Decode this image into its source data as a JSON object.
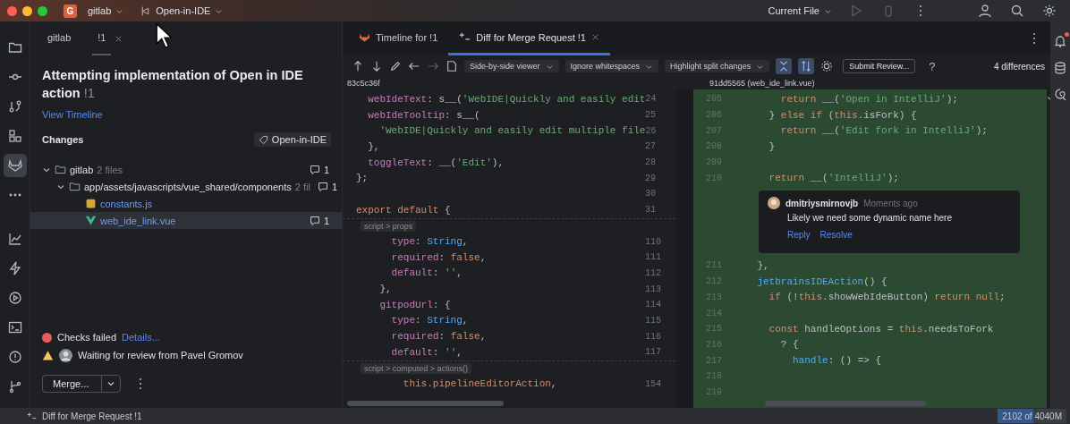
{
  "title_bar": {
    "project_initial": "G",
    "project": "gitlab",
    "branch": "Open-in-IDE",
    "run_config": "Current File",
    "run_disabled": true
  },
  "left_toolbar": {
    "top": [
      {
        "kind": "folder",
        "selected": false
      },
      {
        "kind": "commit",
        "selected": false
      },
      {
        "kind": "pull",
        "selected": false
      },
      {
        "kind": "structure",
        "selected": false
      },
      {
        "kind": "fox",
        "selected": true
      },
      {
        "kind": "more",
        "selected": false
      }
    ],
    "bottom": [
      {
        "kind": "chart",
        "selected": false
      },
      {
        "kind": "bolt",
        "selected": false
      },
      {
        "kind": "play",
        "selected": false
      },
      {
        "kind": "terminal",
        "selected": false
      },
      {
        "kind": "problems",
        "selected": false
      },
      {
        "kind": "git",
        "selected": false
      }
    ]
  },
  "review_panel": {
    "tabs": [
      {
        "label": "gitlab",
        "selected": false
      },
      {
        "label": "!1",
        "selected": true
      }
    ],
    "title": "Attempting implementation of Open in IDE action",
    "title_id": "!1",
    "timeline_link": "View Timeline",
    "changes_label": "Changes",
    "branch_button": "Open-in-IDE",
    "tree": [
      {
        "kind": "dir",
        "name": "gitlab",
        "meta": "2 files",
        "comments": "1",
        "expanded": true,
        "selected": false,
        "children": [
          {
            "kind": "dir",
            "name": "app/assets/javascripts/vue_shared/components",
            "meta": "2 fil",
            "comments": "1",
            "expanded": true,
            "selected": false,
            "children": [
              {
                "kind": "js",
                "name": "constants.js",
                "selected": false
              },
              {
                "kind": "vue",
                "name": "web_ide_link.vue",
                "comments": "1",
                "selected": true
              }
            ]
          }
        ]
      }
    ],
    "checks": {
      "failed": true,
      "label": "Checks failed",
      "link": "Details..."
    },
    "review_status": "Waiting for review from Pavel Gromov",
    "merge_button": "Merge..."
  },
  "editor_tabs": [
    {
      "kind": "fox",
      "label": "Timeline for !1",
      "selected": false
    },
    {
      "kind": "diff",
      "label": "Diff for Merge Request !1",
      "selected": true
    }
  ],
  "diff_toolbar": {
    "dropdowns": [
      "Side-by-side viewer",
      "Ignore whitespaces",
      "Highlight split changes"
    ],
    "toggles": [
      {
        "kind": "collapse",
        "selected": true
      },
      {
        "kind": "sync",
        "selected": true
      }
    ],
    "submit_button": "Submit Review...",
    "help": "?",
    "differences": "4 differences"
  },
  "left_file": "83c5c36f",
  "right_file": "91dd5565 (web_ide_link.vue)",
  "left_lines": [
    {
      "kind": "line",
      "n": "24",
      "code": [
        {
          "kind": "prop",
          "t": "  webIdeText"
        },
        {
          "kind": "plain",
          "t": ": s__("
        },
        {
          "kind": "str",
          "t": "'WebIDE|Quickly and easily edit"
        }
      ]
    },
    {
      "kind": "line",
      "n": "25",
      "code": [
        {
          "kind": "prop",
          "t": "  webIdeTooltip"
        },
        {
          "kind": "plain",
          "t": ": s__("
        }
      ]
    },
    {
      "kind": "line",
      "n": "26",
      "code": [
        {
          "kind": "str",
          "t": "    'WebIDE|Quickly and easily edit multiple file"
        }
      ]
    },
    {
      "kind": "line",
      "n": "27",
      "code": [
        {
          "kind": "plain",
          "t": "  },"
        }
      ]
    },
    {
      "kind": "line",
      "n": "28",
      "code": [
        {
          "kind": "prop",
          "t": "  toggleText"
        },
        {
          "kind": "plain",
          "t": ": __("
        },
        {
          "kind": "str",
          "t": "'Edit'"
        },
        {
          "kind": "plain",
          "t": "),"
        }
      ]
    },
    {
      "kind": "line",
      "n": "29",
      "code": [
        {
          "kind": "plain",
          "t": "};"
        }
      ]
    },
    {
      "kind": "line",
      "n": "30"
    },
    {
      "kind": "line",
      "n": "31",
      "code": [
        {
          "kind": "kw",
          "t": "export default"
        },
        {
          "kind": "plain",
          "t": " {"
        }
      ]
    },
    {
      "kind": "fold",
      "label": "script > props"
    },
    {
      "kind": "line",
      "n": "110",
      "code": [
        {
          "kind": "prop",
          "t": "      type"
        },
        {
          "kind": "plain",
          "t": ": "
        },
        {
          "kind": "type",
          "t": "String"
        },
        {
          "kind": "plain",
          "t": ","
        }
      ]
    },
    {
      "kind": "line",
      "n": "111",
      "code": [
        {
          "kind": "prop",
          "t": "      required"
        },
        {
          "kind": "plain",
          "t": ": "
        },
        {
          "kind": "kw",
          "t": "false"
        },
        {
          "kind": "plain",
          "t": ","
        }
      ]
    },
    {
      "kind": "line",
      "n": "112",
      "code": [
        {
          "kind": "prop",
          "t": "      default"
        },
        {
          "kind": "plain",
          "t": ": "
        },
        {
          "kind": "str",
          "t": "''"
        },
        {
          "kind": "plain",
          "t": ","
        }
      ]
    },
    {
      "kind": "line",
      "n": "113",
      "code": [
        {
          "kind": "plain",
          "t": "    },"
        }
      ]
    },
    {
      "kind": "line",
      "n": "114",
      "code": [
        {
          "kind": "prop",
          "t": "    gitpodUrl"
        },
        {
          "kind": "plain",
          "t": ": {"
        }
      ]
    },
    {
      "kind": "line",
      "n": "115",
      "code": [
        {
          "kind": "prop",
          "t": "      type"
        },
        {
          "kind": "plain",
          "t": ": "
        },
        {
          "kind": "type",
          "t": "String"
        },
        {
          "kind": "plain",
          "t": ","
        }
      ]
    },
    {
      "kind": "line",
      "n": "116",
      "code": [
        {
          "kind": "prop",
          "t": "      required"
        },
        {
          "kind": "plain",
          "t": ": "
        },
        {
          "kind": "kw",
          "t": "false"
        },
        {
          "kind": "plain",
          "t": ","
        }
      ]
    },
    {
      "kind": "line",
      "n": "117",
      "code": [
        {
          "kind": "prop",
          "t": "      default"
        },
        {
          "kind": "plain",
          "t": ": "
        },
        {
          "kind": "str",
          "t": "''"
        },
        {
          "kind": "plain",
          "t": ","
        }
      ]
    },
    {
      "kind": "fold",
      "label": "script > computed > actions()"
    },
    {
      "kind": "line",
      "n": "154",
      "code": [
        {
          "kind": "kw",
          "t": "        this.pipelineEditorAction"
        },
        {
          "kind": "plain",
          "t": ","
        }
      ]
    }
  ],
  "right_lines": [
    {
      "kind": "line",
      "n": "205",
      "code": [
        {
          "kind": "kw",
          "t": "        return"
        },
        {
          "kind": "plain",
          "t": " __("
        },
        {
          "kind": "str",
          "t": "'Open in IntelliJ'"
        },
        {
          "kind": "plain",
          "t": ");"
        }
      ]
    },
    {
      "kind": "line",
      "n": "206",
      "code": [
        {
          "kind": "plain",
          "t": "      } "
        },
        {
          "kind": "kw",
          "t": "else if"
        },
        {
          "kind": "plain",
          "t": " ("
        },
        {
          "kind": "kw",
          "t": "this"
        },
        {
          "kind": "plain",
          "t": ".isFork) {"
        }
      ]
    },
    {
      "kind": "line",
      "n": "207",
      "code": [
        {
          "kind": "kw",
          "t": "        return"
        },
        {
          "kind": "plain",
          "t": " __("
        },
        {
          "kind": "str",
          "t": "'Edit fork in IntelliJ'"
        },
        {
          "kind": "plain",
          "t": ");"
        }
      ]
    },
    {
      "kind": "line",
      "n": "208",
      "code": [
        {
          "kind": "plain",
          "t": "      }"
        }
      ]
    },
    {
      "kind": "line",
      "n": "209"
    },
    {
      "kind": "line",
      "n": "210",
      "code": [
        {
          "kind": "kw",
          "t": "      return"
        },
        {
          "kind": "plain",
          "t": " __("
        },
        {
          "kind": "str",
          "t": "'IntelliJ'"
        },
        {
          "kind": "plain",
          "t": ");"
        }
      ]
    },
    {
      "kind": "comment",
      "author": "dmitriysmirnovjb",
      "time": "Moments ago",
      "body": "Likely we need some dynamic name here",
      "actions": [
        "Reply",
        "Resolve"
      ]
    },
    {
      "kind": "line",
      "n": "211",
      "code": [
        {
          "kind": "plain",
          "t": "    },"
        }
      ]
    },
    {
      "kind": "line",
      "n": "212",
      "code": [
        {
          "kind": "fn",
          "t": "    jetbrainsIDEAction"
        },
        {
          "kind": "plain",
          "t": "() {"
        }
      ]
    },
    {
      "kind": "line",
      "n": "213",
      "code": [
        {
          "kind": "kw",
          "t": "      if"
        },
        {
          "kind": "plain",
          "t": " (!"
        },
        {
          "kind": "kw",
          "t": "this"
        },
        {
          "kind": "plain",
          "t": ".showWebIdeButton) "
        },
        {
          "kind": "kw",
          "t": "return null"
        },
        {
          "kind": "plain",
          "t": ";"
        }
      ]
    },
    {
      "kind": "line",
      "n": "214"
    },
    {
      "kind": "line",
      "n": "215",
      "code": [
        {
          "kind": "kw",
          "t": "      const"
        },
        {
          "kind": "plain",
          "t": " handleOptions = "
        },
        {
          "kind": "kw",
          "t": "this"
        },
        {
          "kind": "plain",
          "t": ".needsToFork"
        }
      ]
    },
    {
      "kind": "line",
      "n": "216",
      "code": [
        {
          "kind": "plain",
          "t": "        ? {"
        }
      ]
    },
    {
      "kind": "line",
      "n": "217",
      "code": [
        {
          "kind": "fn",
          "t": "          handle"
        },
        {
          "kind": "plain",
          "t": ": () => {"
        }
      ]
    },
    {
      "kind": "line",
      "n": "218"
    },
    {
      "kind": "line",
      "n": "219"
    }
  ],
  "right_toolbar": [
    {
      "kind": "bell",
      "badge": true
    },
    {
      "kind": "database",
      "badge": false
    },
    {
      "kind": "assistant",
      "badge": false
    }
  ],
  "status_bar": {
    "left": "Diff for Merge Request !1",
    "memory": {
      "text": "2102 of 4040M",
      "level": 0.52
    }
  }
}
